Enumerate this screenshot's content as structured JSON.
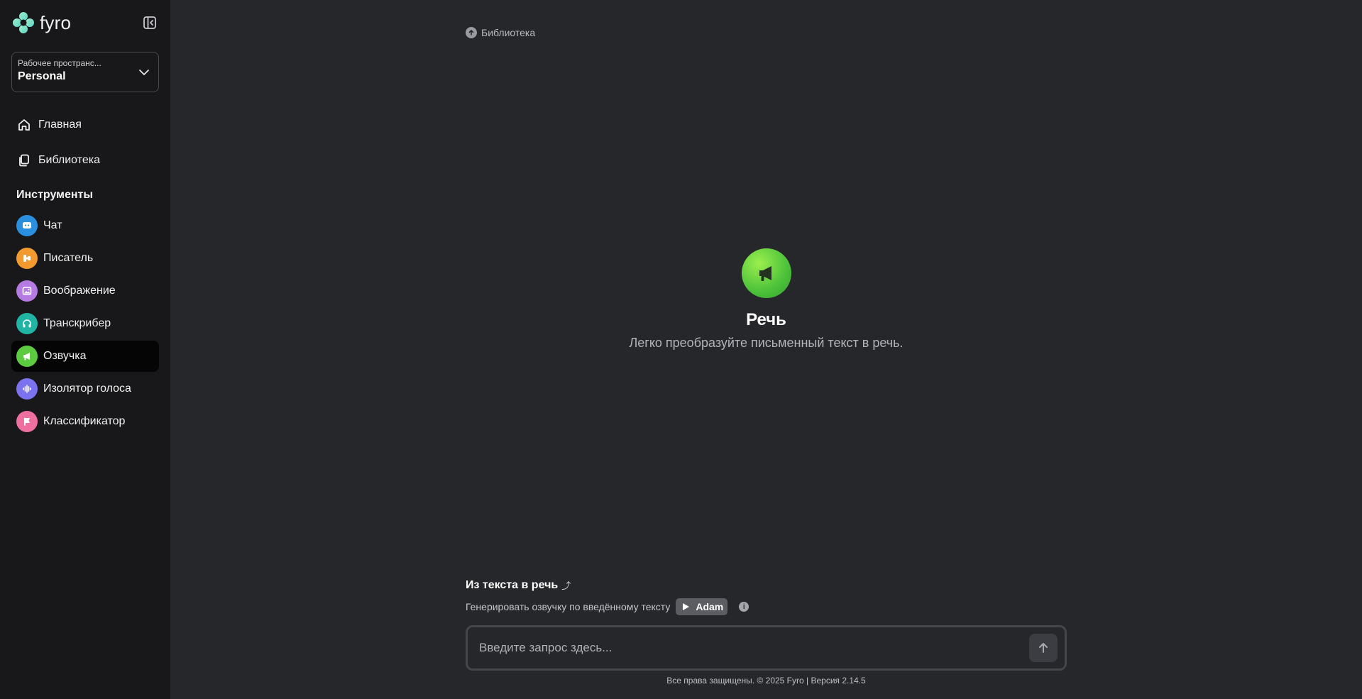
{
  "brand": {
    "name": "fyro"
  },
  "workspace": {
    "label": "Рабочее пространс...",
    "value": "Personal"
  },
  "nav": [
    {
      "label": "Главная",
      "icon": "home-icon"
    },
    {
      "label": "Библиотека",
      "icon": "library-icon"
    }
  ],
  "tools_title": "Инструменты",
  "tools": [
    {
      "label": "Чат",
      "icon": "chat-icon",
      "color": "#2b8fe0"
    },
    {
      "label": "Писатель",
      "icon": "writer-icon",
      "color": "#f29a2e"
    },
    {
      "label": "Воображение",
      "icon": "image-icon",
      "color": "#b57be3"
    },
    {
      "label": "Транскрибер",
      "icon": "headphones-icon",
      "color": "#1fb4a3"
    },
    {
      "label": "Озвучка",
      "icon": "megaphone-icon",
      "color": "#5ccb3f",
      "active": true
    },
    {
      "label": "Изолятор голоса",
      "icon": "waveform-icon",
      "color": "#7b72f0"
    },
    {
      "label": "Классификатор",
      "icon": "flag-icon",
      "color": "#ee6fa0"
    }
  ],
  "breadcrumb": {
    "label": "Библиотека"
  },
  "hero": {
    "title": "Речь",
    "subtitle": "Легко преобразуйте письменный текст в речь."
  },
  "composer": {
    "title": "Из текста в речь",
    "title_arrow": "⤴",
    "subtitle": "Генерировать озвучку по введённому тексту",
    "voice": "Adam",
    "info": "i",
    "placeholder": "Введите запрос здесь...",
    "value": ""
  },
  "footer": "Все права защищены. © 2025 Fyro | Версия 2.14.5"
}
